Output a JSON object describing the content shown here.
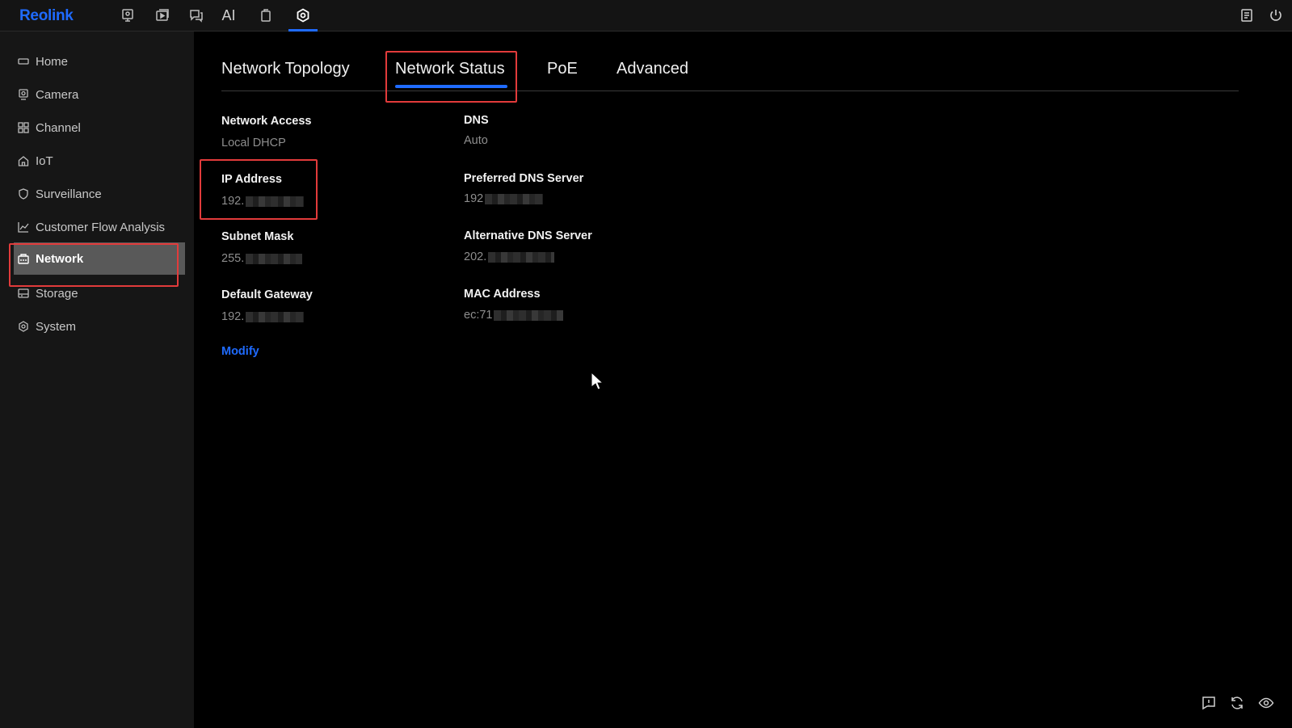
{
  "app": {
    "logo": "Reolink"
  },
  "topbar": {
    "icons": [
      "monitor-icon",
      "playback-icon",
      "chat-icon",
      "ai-icon",
      "device-icon",
      "settings-icon"
    ],
    "ai_label": "AI",
    "right_icons": [
      "notes-icon",
      "power-icon"
    ]
  },
  "sidebar": {
    "items": [
      {
        "label": "Home",
        "icon": "home-icon"
      },
      {
        "label": "Camera",
        "icon": "camera-icon"
      },
      {
        "label": "Channel",
        "icon": "channel-icon"
      },
      {
        "label": "IoT",
        "icon": "iot-icon"
      },
      {
        "label": "Surveillance",
        "icon": "shield-icon"
      },
      {
        "label": "Customer Flow Analysis",
        "icon": "chart-icon"
      },
      {
        "label": "Network",
        "icon": "network-icon",
        "active": true
      },
      {
        "label": "Storage",
        "icon": "storage-icon"
      },
      {
        "label": "System",
        "icon": "gear-icon"
      }
    ]
  },
  "tabs": [
    {
      "label": "Network Topology"
    },
    {
      "label": "Network Status",
      "active": true
    },
    {
      "label": "PoE"
    },
    {
      "label": "Advanced"
    }
  ],
  "fields": {
    "network_access": {
      "label": "Network Access",
      "value": "Local DHCP"
    },
    "ip_address": {
      "label": "IP Address",
      "value": "192."
    },
    "subnet_mask": {
      "label": "Subnet Mask",
      "value": "255."
    },
    "default_gateway": {
      "label": "Default Gateway",
      "value": "192."
    },
    "dns": {
      "label": "DNS",
      "value": "Auto"
    },
    "preferred_dns": {
      "label": "Preferred DNS Server",
      "value": "192"
    },
    "alternative_dns": {
      "label": "Alternative DNS Server",
      "value": "202."
    },
    "mac_address": {
      "label": "MAC Address",
      "value": "ec:71"
    }
  },
  "modify_label": "Modify",
  "bottom_icons": [
    "feedback-icon",
    "refresh-icon",
    "eye-icon"
  ],
  "colors": {
    "accent": "#1f6bff",
    "highlight": "#e23b3b",
    "sidebar_active": "#595959"
  }
}
